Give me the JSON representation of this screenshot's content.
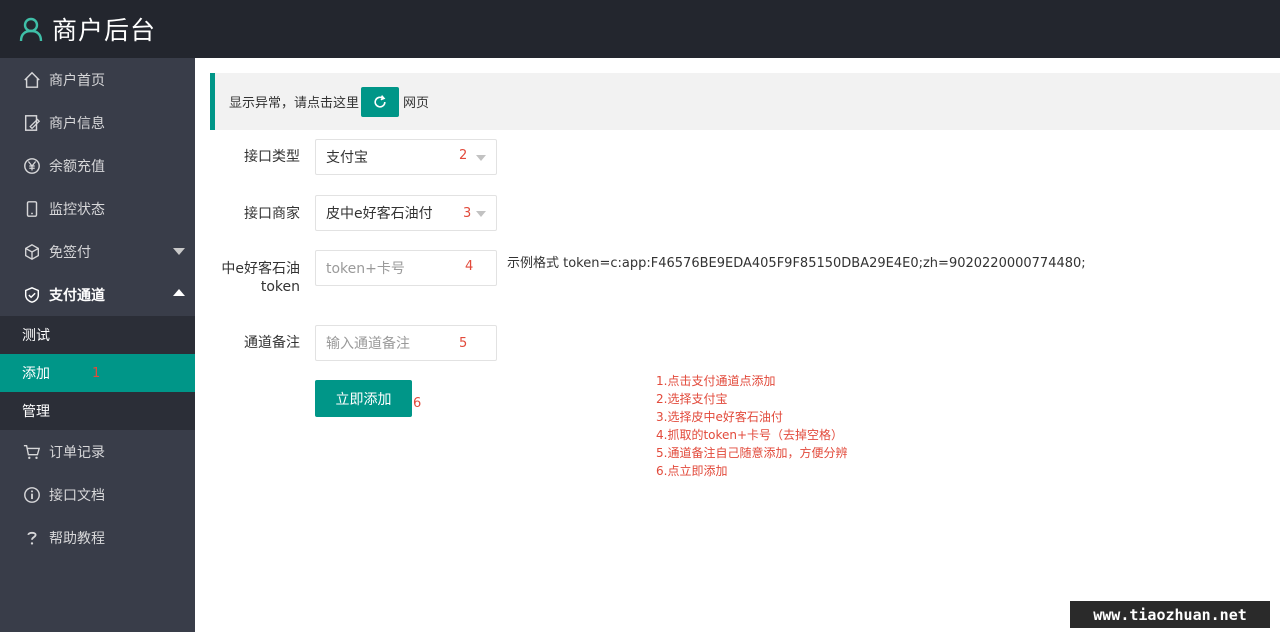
{
  "app": {
    "title": "商户后台"
  },
  "sidebar": {
    "items": [
      {
        "label": "商户首页",
        "icon": "home-icon"
      },
      {
        "label": "商户信息",
        "icon": "edit-document-icon"
      },
      {
        "label": "余额充值",
        "icon": "yen-icon"
      },
      {
        "label": "监控状态",
        "icon": "phone-icon"
      },
      {
        "label": "免签付",
        "icon": "cube-icon"
      },
      {
        "label": "支付通道",
        "icon": "shield-icon"
      },
      {
        "label": "订单记录",
        "icon": "cart-icon"
      },
      {
        "label": "接口文档",
        "icon": "info-icon"
      },
      {
        "label": "帮助教程",
        "icon": "question-icon"
      }
    ],
    "submenu": [
      {
        "label": "测试"
      },
      {
        "label": "添加",
        "annotation": "1"
      },
      {
        "label": "管理"
      }
    ]
  },
  "notice": {
    "text_before": "显示异常，请点击这里",
    "text_after": "网页"
  },
  "form": {
    "type_label": "接口类型",
    "type_value": "支付宝",
    "type_annotation": "2",
    "merchant_label": "接口商家",
    "merchant_value": "皮中e好客石油付",
    "merchant_annotation": "3",
    "token_label_line1": "中e好客石油",
    "token_label_line2": "token",
    "token_placeholder": "token+卡号",
    "token_annotation": "4",
    "example_text": "示例格式 token=c:app:F46576BE9EDA405F9F85150DBA29E4E0;zh=9020220000774480;",
    "remark_label": "通道备注",
    "remark_placeholder": "输入通道备注",
    "remark_annotation": "5",
    "submit_label": "立即添加",
    "submit_annotation": "6"
  },
  "instructions": [
    "1.点击支付通道点添加",
    "2.选择支付宝",
    "3.选择皮中e好客石油付",
    "4.抓取的token+卡号（去掉空格）",
    "5.通道备注自己随意添加，方便分辨",
    "6.点立即添加"
  ],
  "watermark": "www.tiaozhuan.net",
  "colors": {
    "accent": "#009688",
    "header": "#23262e",
    "sidebar": "#393d49",
    "annotation": "#e24a3b"
  }
}
